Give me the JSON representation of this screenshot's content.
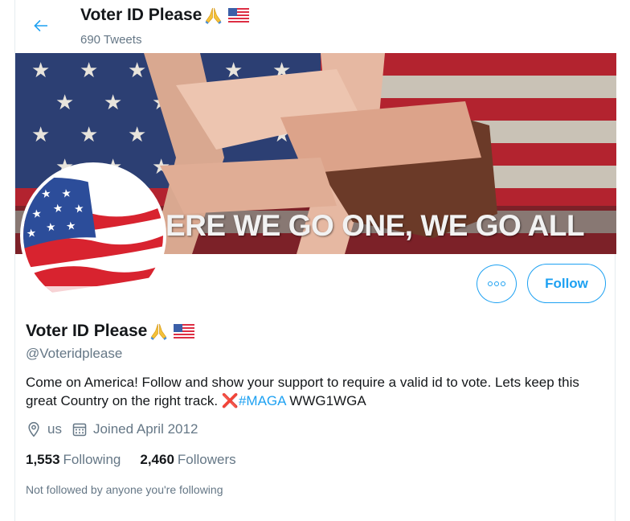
{
  "header": {
    "name": "Voter ID Please",
    "tweet_count": "690 Tweets"
  },
  "banner": {
    "text": "ERE WE GO ONE, WE GO ALL"
  },
  "actions": {
    "follow_label": "Follow"
  },
  "profile": {
    "name": "Voter ID Please",
    "handle": "@Voteridplease",
    "bio_text": "Come on America! Follow and show your support to require a valid id to vote. Lets keep this great Country on the right track. ",
    "bio_cross": "❌",
    "bio_hashtag": "#MAGA",
    "bio_tail": " WWG1WGA",
    "location": "us",
    "joined": "Joined April 2012",
    "following_count": "1,553",
    "following_label": "Following",
    "followers_count": "2,460",
    "followers_label": "Followers",
    "not_followed": "Not followed by anyone you're following"
  },
  "colors": {
    "accent": "#1da1f2",
    "muted": "#657786",
    "text": "#14171a"
  },
  "icons": [
    "back-arrow-icon",
    "praying-hands-emoji",
    "us-flag-emoji",
    "more-dots-icon",
    "location-pin-icon",
    "calendar-icon"
  ]
}
